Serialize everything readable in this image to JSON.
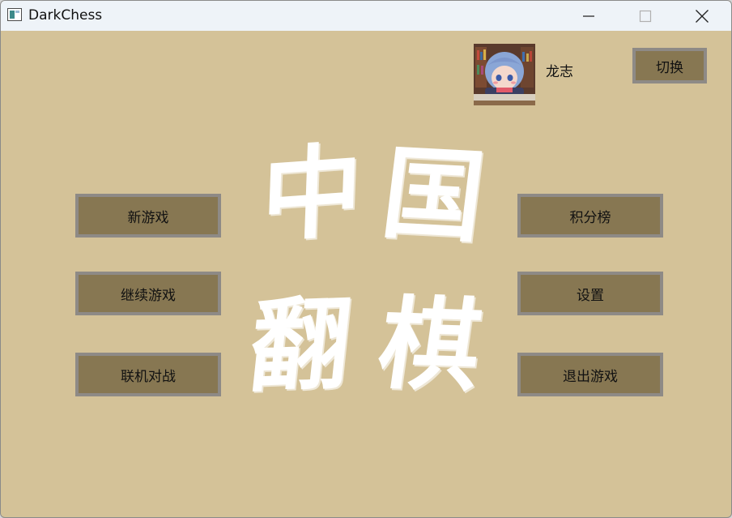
{
  "window": {
    "title": "DarkChess"
  },
  "user": {
    "name": "龙志",
    "switch_label": "切换"
  },
  "logo": {
    "chars": [
      "中",
      "国",
      "翻",
      "棋"
    ]
  },
  "menu": {
    "left": [
      "新游戏",
      "继续游戏",
      "联机对战"
    ],
    "right": [
      "积分榜",
      "设置",
      "退出游戏"
    ]
  },
  "colors": {
    "background": "#d4c298",
    "button_fill": "#877752",
    "button_border": "#8e8a86",
    "logo": "#ffffff"
  }
}
